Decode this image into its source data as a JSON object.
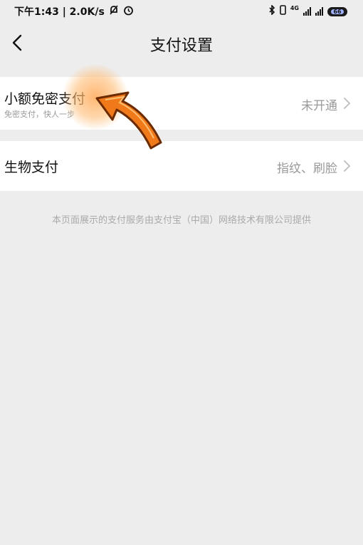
{
  "status_bar": {
    "time_speed": "下午1:43 | 2.0K/s",
    "network_badge": "4G",
    "battery_level": "66"
  },
  "nav": {
    "title": "支付设置"
  },
  "settings": [
    {
      "title": "小额免密支付",
      "subtitle": "免密支付，快人一步",
      "value": "未开通"
    },
    {
      "title": "生物支付",
      "value": "指纹、刷脸"
    }
  ],
  "footer_note": "本页面展示的支付服务由支付宝（中国）网络技术有限公司提供",
  "colors": {
    "background": "#ededed",
    "row_bg": "#ffffff",
    "muted_text": "#999999",
    "arrow_orange": "#f07a1a"
  }
}
